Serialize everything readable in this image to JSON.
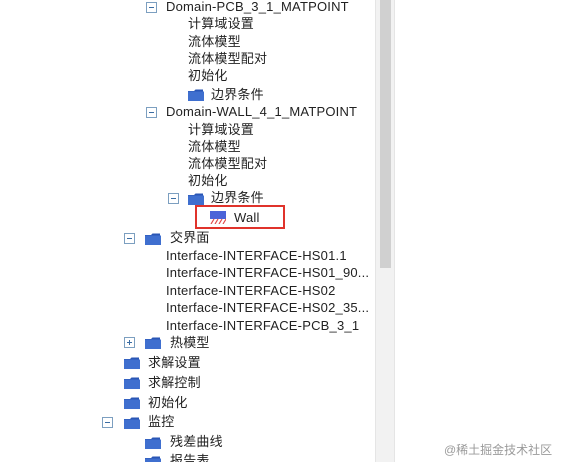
{
  "tree": {
    "domain_pcb": {
      "label": "Domain-PCB_3_1_MATPOINT",
      "children": [
        "计算域设置",
        "流体模型",
        "流体模型配对",
        "初始化"
      ],
      "boundary": "边界条件"
    },
    "domain_wall": {
      "label": "Domain-WALL_4_1_MATPOINT",
      "children": [
        "计算域设置",
        "流体模型",
        "流体模型配对",
        "初始化"
      ],
      "boundary": "边界条件",
      "wall": "Wall"
    },
    "interfaces": {
      "label": "交界面",
      "items": [
        "Interface-INTERFACE-HS01.1",
        "Interface-INTERFACE-HS01_90...",
        "Interface-INTERFACE-HS02",
        "Interface-INTERFACE-HS02_35...",
        "Interface-INTERFACE-PCB_3_1"
      ]
    },
    "thermal_model": "热模型",
    "solver_settings": "求解设置",
    "solver_control": "求解控制",
    "initialization": "初始化",
    "monitor": {
      "label": "监控",
      "residual": "残差曲线",
      "report": "报告表"
    }
  },
  "watermark": "@稀土掘金技术社区",
  "colors": {
    "folder": "#3f6fcf",
    "folder_dark": "#2a56b5",
    "highlight": "#e0332b",
    "wall_top": "#4b63d8",
    "wall_hatch": "#e04a4a"
  },
  "icons": {
    "folder": "folder-icon",
    "wall": "wall-boundary-icon",
    "toggle_open": "collapse-toggle-icon",
    "toggle_closed": "expand-toggle-icon"
  }
}
